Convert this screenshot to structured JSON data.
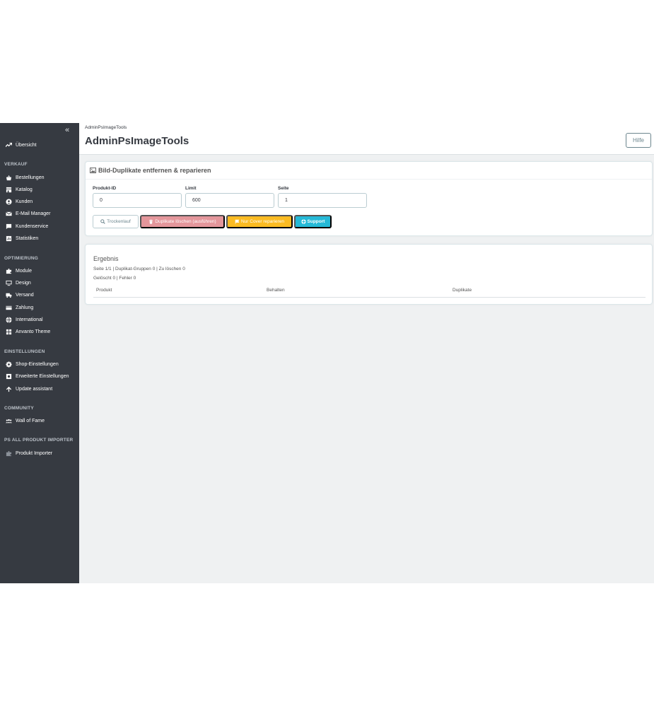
{
  "sidebar": {
    "collapse_icon": "double-chevron-left-icon",
    "overview": {
      "label": "Übersicht",
      "icon": "trend-icon"
    },
    "sections": {
      "verkauf": "VERKAUF",
      "optimierung": "OPTIMIERUNG",
      "einstellungen": "EINSTELLUNGEN",
      "community": "COMMUNITY",
      "importer": "PS ALL PRODUKT IMPORTER"
    },
    "items": {
      "bestellungen": "Bestellungen",
      "katalog": "Katalog",
      "kunden": "Kunden",
      "email": "E-Mail Manager",
      "kundenservice": "Kundenservice",
      "statistiken": "Statistiken",
      "module": "Module",
      "design": "Design",
      "versand": "Versand",
      "zahlung": "Zahlung",
      "international": "International",
      "anvanto": "Anvanto Theme",
      "shop_einstellungen": "Shop-Einstellungen",
      "erweiterte": "Erweiterte Einstellungen",
      "update": "Update assistant",
      "wall": "Wall of Fame",
      "produkt_importer": "Produkt Importer"
    }
  },
  "header": {
    "breadcrumb": "AdminPsImageTools",
    "title": "AdminPsImageTools",
    "help_label": "Hilfe"
  },
  "tool_panel": {
    "heading": "Bild-Duplikate entfernen & reparieren",
    "fields": {
      "product_id": {
        "label": "Produkt-ID",
        "value": "0"
      },
      "limit": {
        "label": "Limit",
        "value": "600"
      },
      "page": {
        "label": "Seite",
        "value": "1"
      }
    },
    "buttons": {
      "dry_run": "Trockenlauf",
      "delete": "Duplikate löschen (ausführen)",
      "cover": "Nur Cover reparieren",
      "support": "Support"
    }
  },
  "result_panel": {
    "title": "Ergebnis",
    "line1": "Seite 1/1 | Duplikat-Gruppen 0 | Zu löschen 0",
    "line2": "Gelöscht 0 | Fehler 0",
    "columns": [
      "Produkt",
      "Behalten",
      "Duplikate"
    ]
  },
  "colors": {
    "sidebar_bg": "#363a41",
    "main_bg": "#eff1f2",
    "delete_btn": "#e4969b",
    "cover_btn": "#fbbb22",
    "support_btn": "#25b9d7"
  }
}
